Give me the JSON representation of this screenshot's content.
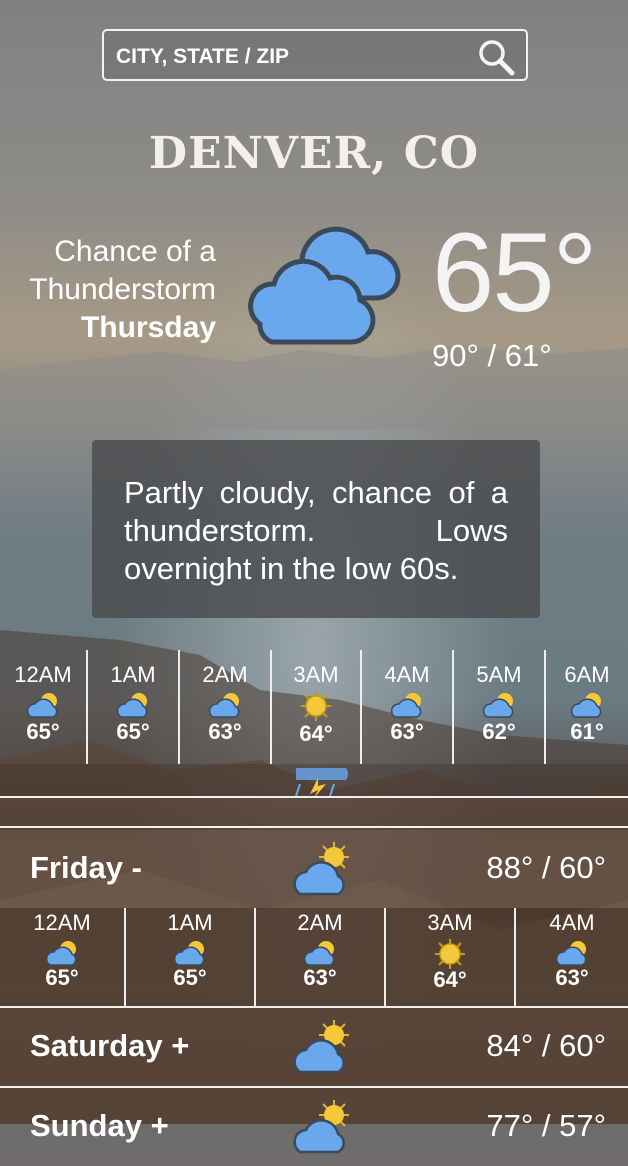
{
  "search": {
    "placeholder": "CITY, STATE / ZIP",
    "icon": "search-icon"
  },
  "location": "DENVER, CO",
  "current": {
    "condition_line1": "Chance of a",
    "condition_line2": "Thunderstorm",
    "day": "Thursday",
    "temp": "65°",
    "hilo": "90° / 61°",
    "icon": "partly-cloudy-icon",
    "description": "Partly cloudy, chance of a thunderstorm. Lows overnight in the low 60s."
  },
  "hourly": [
    {
      "time": "12AM",
      "temp": "65°",
      "icon": "partly-cloudy-icon"
    },
    {
      "time": "1AM",
      "temp": "65°",
      "icon": "partly-cloudy-icon"
    },
    {
      "time": "2AM",
      "temp": "63°",
      "icon": "partly-cloudy-icon"
    },
    {
      "time": "3AM",
      "temp": "64°",
      "icon": "sun-icon"
    },
    {
      "time": "4AM",
      "temp": "63°",
      "icon": "partly-cloudy-icon"
    },
    {
      "time": "5AM",
      "temp": "62°",
      "icon": "partly-cloudy-icon"
    },
    {
      "time": "6AM",
      "temp": "61°",
      "icon": "partly-cloudy-icon"
    }
  ],
  "days": [
    {
      "name": "Friday -",
      "temps": "88° / 60°",
      "icon": "partly-cloudy-icon"
    },
    {
      "name": "Saturday +",
      "temps": "84° / 60°",
      "icon": "partly-cloudy-icon"
    },
    {
      "name": "Sunday +",
      "temps": "77° / 57°",
      "icon": "partly-cloudy-icon"
    }
  ],
  "friday_hourly": [
    {
      "time": "12AM",
      "temp": "65°",
      "icon": "partly-cloudy-icon"
    },
    {
      "time": "1AM",
      "temp": "65°",
      "icon": "partly-cloudy-icon"
    },
    {
      "time": "2AM",
      "temp": "63°",
      "icon": "partly-cloudy-icon"
    },
    {
      "time": "3AM",
      "temp": "64°",
      "icon": "sun-icon"
    },
    {
      "time": "4AM",
      "temp": "63°",
      "icon": "partly-cloudy-icon"
    }
  ],
  "colors": {
    "cloud": "#6aa8ee",
    "sun": "#f5c83a",
    "panel": "#46484a"
  }
}
